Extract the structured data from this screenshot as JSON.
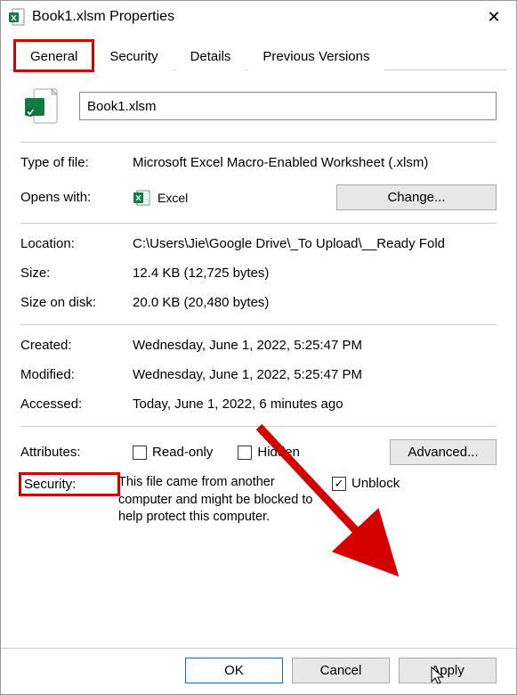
{
  "window": {
    "title": "Book1.xlsm Properties",
    "close_symbol": "✕"
  },
  "tabs": {
    "general": "General",
    "security": "Security",
    "details": "Details",
    "previous": "Previous Versions"
  },
  "filename": "Book1.xlsm",
  "props": {
    "type_label": "Type of file:",
    "type_value": "Microsoft Excel Macro-Enabled Worksheet (.xlsm)",
    "opens_label": "Opens with:",
    "opens_value": "Excel",
    "change_label": "Change...",
    "location_label": "Location:",
    "location_value": "C:\\Users\\Jie\\Google Drive\\_To Upload\\__Ready Fold",
    "size_label": "Size:",
    "size_value": "12.4 KB (12,725 bytes)",
    "sizeondisk_label": "Size on disk:",
    "sizeondisk_value": "20.0 KB (20,480 bytes)",
    "created_label": "Created:",
    "created_value": "Wednesday, June 1, 2022, 5:25:47 PM",
    "modified_label": "Modified:",
    "modified_value": "Wednesday, June 1, 2022, 5:25:47 PM",
    "accessed_label": "Accessed:",
    "accessed_value": "Today, June 1, 2022, 6 minutes ago"
  },
  "attributes": {
    "label": "Attributes:",
    "readonly": "Read-only",
    "hidden": "Hidden",
    "advanced": "Advanced..."
  },
  "securitysection": {
    "label": "Security:",
    "text": "This file came from another computer and might be blocked to help protect this computer.",
    "unblock": "Unblock",
    "checkmark": "✓"
  },
  "footer": {
    "ok": "OK",
    "cancel": "Cancel",
    "apply": "Apply"
  }
}
